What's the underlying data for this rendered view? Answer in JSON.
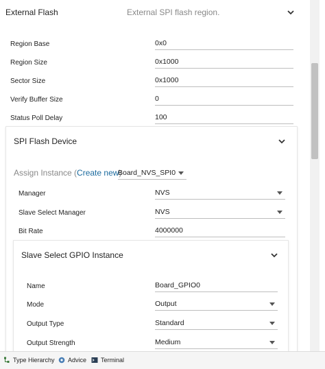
{
  "external_flash": {
    "title": "External Flash",
    "description": "External SPI flash region.",
    "fields": [
      {
        "label": "Region Base",
        "value": "0x0"
      },
      {
        "label": "Region Size",
        "value": "0x1000"
      },
      {
        "label": "Sector Size",
        "value": "0x1000"
      },
      {
        "label": "Verify Buffer Size",
        "value": "0"
      },
      {
        "label": "Status Poll Delay",
        "value": "100"
      }
    ]
  },
  "spi_flash_device": {
    "title": "SPI Flash Device",
    "assign_prefix": "Assign Instance (",
    "create_new": "Create new",
    "assign_suffix": ")",
    "instance": "Board_NVS_SPI0",
    "fields": [
      {
        "label": "Manager",
        "value": "NVS"
      },
      {
        "label": "Slave Select Manager",
        "value": "NVS"
      },
      {
        "label": "Bit Rate",
        "value": "4000000"
      }
    ]
  },
  "gpio_instance": {
    "title": "Slave Select GPIO Instance",
    "fields": [
      {
        "label": "Name",
        "value": "Board_GPIO0"
      },
      {
        "label": "Mode",
        "value": "Output"
      },
      {
        "label": "Output Type",
        "value": "Standard"
      },
      {
        "label": "Output Strength",
        "value": "Medium"
      }
    ]
  },
  "statusbar": {
    "items": [
      {
        "label": "Type Hierarchy",
        "icon": "type-hierarchy-icon"
      },
      {
        "label": "Advice",
        "icon": "advice-icon"
      },
      {
        "label": "Terminal",
        "icon": "terminal-icon"
      }
    ]
  }
}
